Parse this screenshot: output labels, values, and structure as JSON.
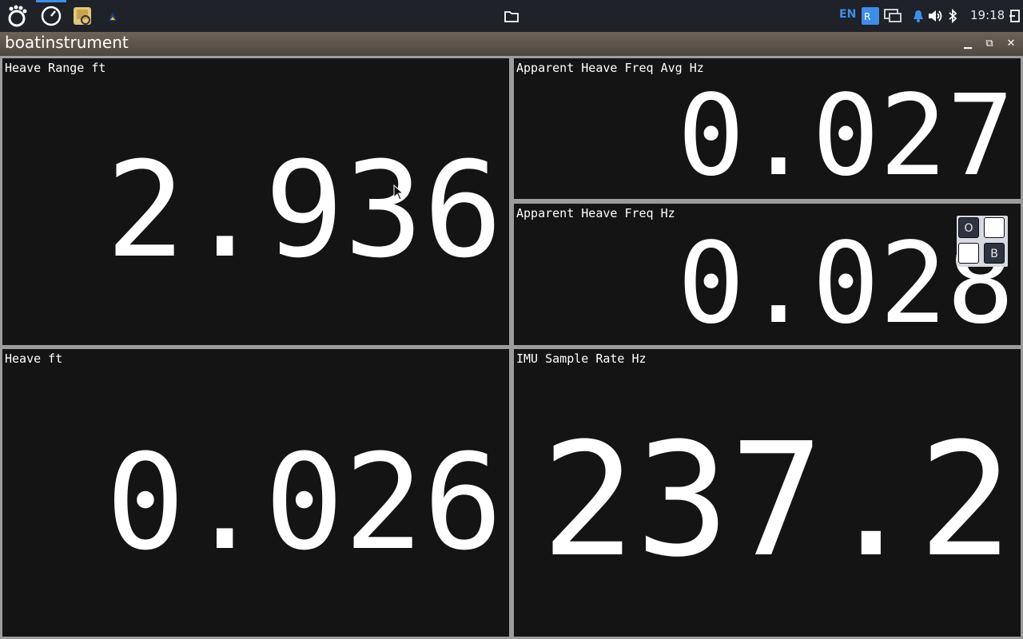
{
  "taskbar": {
    "language": "EN",
    "clock": "19:18",
    "icons": [
      "gnome-foot-icon",
      "speedometer-icon",
      "file-manager-icon",
      "app-icon",
      "folder-icon",
      "input-method-icon",
      "network-icon",
      "notification-bell-icon",
      "volume-icon",
      "bluetooth-icon",
      "logout-icon"
    ]
  },
  "window": {
    "title": "boatinstrument",
    "buttons": [
      "minimize",
      "restore",
      "close"
    ]
  },
  "panels": {
    "heave_range": {
      "label": "Heave Range ft",
      "value": "2.936"
    },
    "freq_avg": {
      "label": "Apparent Heave Freq Avg Hz",
      "value": "0.027"
    },
    "freq": {
      "label": "Apparent Heave Freq Hz",
      "value": "0.028"
    },
    "heave": {
      "label": "Heave ft",
      "value": "0.026"
    },
    "imu_rate": {
      "label": "IMU Sample Rate Hz",
      "value": "237.2"
    }
  },
  "overlay": {
    "top_left": "O",
    "bottom_right": "B"
  }
}
